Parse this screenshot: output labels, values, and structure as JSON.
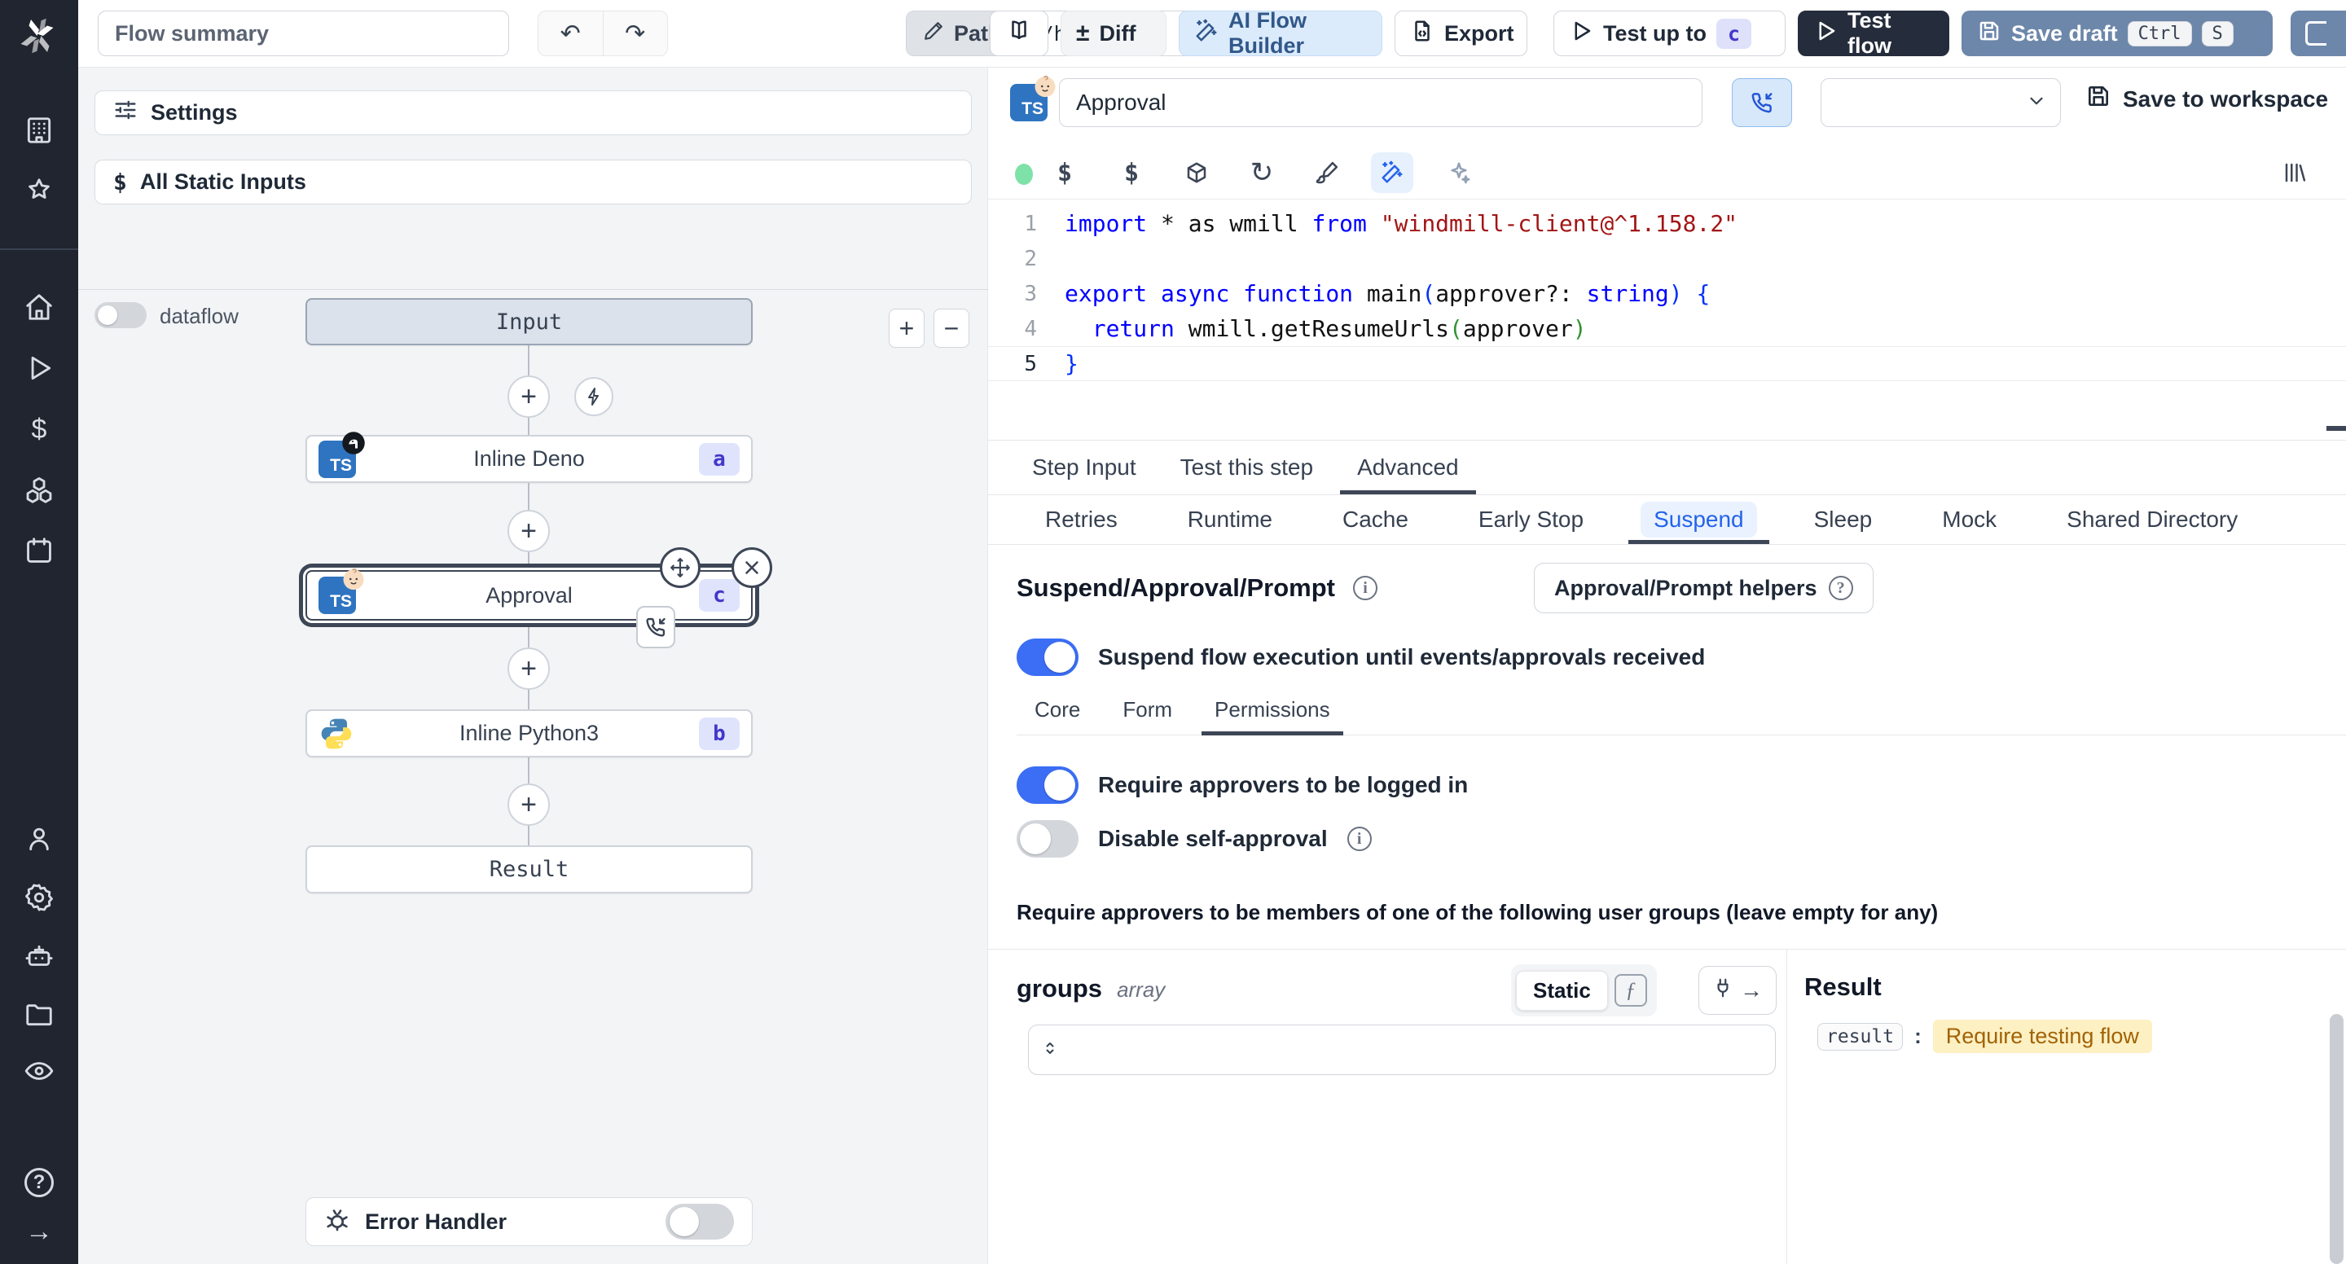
{
  "colors": {
    "accent_blue": "#3b82f6",
    "active_tab_blue": "#2563eb",
    "save_draft_bg": "#6d87aa",
    "test_flow_bg": "#252d3c",
    "ai_builder_bg": "#dcebfb",
    "badge_bg": "#dfe4fc",
    "badge_text": "#4338ca",
    "result_highlight_bg": "#fdf0c2",
    "result_highlight_text": "#a16207",
    "status_dot_green": "#7ee2a8",
    "sidebar_bg": "#20252f",
    "panel_bg": "#f3f4f6"
  },
  "sidebar": {
    "items_top": [
      "workspace",
      "favorites"
    ],
    "items_main": [
      "home",
      "runs",
      "variables",
      "resources",
      "schedules"
    ],
    "items_admin": [
      "users",
      "settings",
      "workers",
      "folders",
      "audit-logs"
    ],
    "items_bottom": [
      "help",
      "collapse"
    ]
  },
  "toolbar": {
    "flow_summary_placeholder": "Flow summary",
    "path_label": "Path",
    "path_value": "u/henri/bes",
    "diff_label": "Diff",
    "ai_flow_builder_label": "AI Flow Builder",
    "export_label": "Export",
    "test_up_to_label": "Test up to",
    "test_up_to_badge": "c",
    "test_flow_label": "Test flow",
    "save_draft_label": "Save draft",
    "kbd_ctrl": "Ctrl",
    "kbd_s": "S"
  },
  "left_panel": {
    "settings_label": "Settings",
    "all_static_inputs_label": "All Static Inputs",
    "dataflow_label": "dataflow",
    "error_handler_label": "Error Handler"
  },
  "graph": {
    "input_label": "Input",
    "nodes": [
      {
        "label": "Inline Deno",
        "badge": "a",
        "lang": "deno-typescript"
      },
      {
        "label": "Approval",
        "badge": "c",
        "lang": "bun-typescript",
        "selected": true
      },
      {
        "label": "Inline Python3",
        "badge": "b",
        "lang": "python3"
      }
    ],
    "result_label": "Result"
  },
  "editor": {
    "step_name": "Approval",
    "save_to_workspace_label": "Save to workspace"
  },
  "code": {
    "lines": [
      {
        "n": "1",
        "tokens": [
          [
            "import",
            "k"
          ],
          [
            " * as wmill ",
            "d"
          ],
          [
            "from",
            "k"
          ],
          [
            " ",
            "d"
          ],
          [
            "\"windmill-client@^1.158.2\"",
            "s"
          ]
        ]
      },
      {
        "n": "2",
        "tokens": []
      },
      {
        "n": "3",
        "tokens": [
          [
            "export",
            "k"
          ],
          [
            " ",
            "d"
          ],
          [
            "async",
            "k"
          ],
          [
            " ",
            "d"
          ],
          [
            "function",
            "k"
          ],
          [
            " main",
            "d"
          ],
          [
            "(",
            "p1"
          ],
          [
            "approver?: ",
            "d"
          ],
          [
            "string",
            "k"
          ],
          [
            ")",
            "p1"
          ],
          [
            " ",
            "d"
          ],
          [
            "{",
            "p1"
          ]
        ]
      },
      {
        "n": "4",
        "tokens": [
          [
            "  ",
            "d"
          ],
          [
            "return",
            "k"
          ],
          [
            " wmill.getResumeUrls",
            "d"
          ],
          [
            "(",
            "p2"
          ],
          [
            "approver",
            "d"
          ],
          [
            ")",
            "p2"
          ]
        ]
      },
      {
        "n": "5",
        "tokens": [
          [
            "}",
            "p1"
          ]
        ],
        "current": true
      }
    ]
  },
  "tabs": {
    "primary": {
      "items": [
        "Step Input",
        "Test this step",
        "Advanced"
      ],
      "active": 2
    },
    "advanced": {
      "items": [
        "Retries",
        "Runtime",
        "Cache",
        "Early Stop",
        "Suspend",
        "Sleep",
        "Mock",
        "Shared Directory"
      ],
      "active": 4
    }
  },
  "suspend": {
    "heading": "Suspend/Approval/Prompt",
    "helpers_button_label": "Approval/Prompt helpers",
    "suspend_toggle_label": "Suspend flow execution until events/approvals received",
    "suspend_toggle_on": true,
    "subtabs": {
      "items": [
        "Core",
        "Form",
        "Permissions"
      ],
      "active": 2
    },
    "require_login_label": "Require approvers to be logged in",
    "require_login_on": true,
    "disable_self_approval_label": "Disable self-approval",
    "disable_self_approval_on": false,
    "groups_note": "Require approvers to be members of one of the following user groups (leave empty for any)",
    "groups": {
      "name": "groups",
      "type": "array",
      "mode_label": "Static",
      "value": ""
    },
    "result": {
      "title": "Result",
      "key": "result",
      "colon": ":",
      "value": "Require testing flow"
    }
  }
}
